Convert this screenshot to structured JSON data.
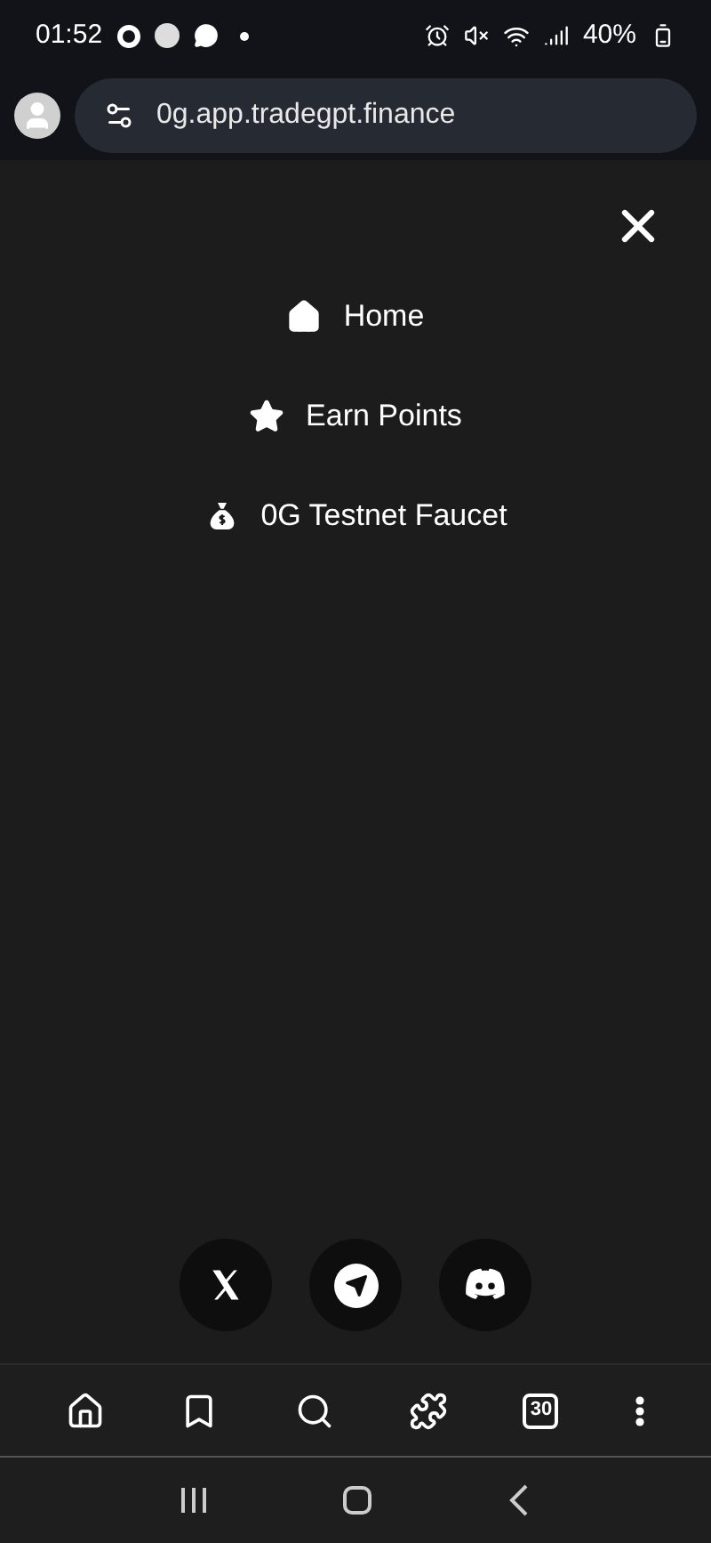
{
  "status_bar": {
    "time": "01:52",
    "battery": "40%"
  },
  "address_bar": {
    "url": "0g.app.tradegpt.finance"
  },
  "menu": {
    "items": [
      {
        "label": "Home"
      },
      {
        "label": "Earn Points"
      },
      {
        "label": "0G Testnet Faucet"
      }
    ]
  },
  "toolbar": {
    "tab_count": "30"
  }
}
